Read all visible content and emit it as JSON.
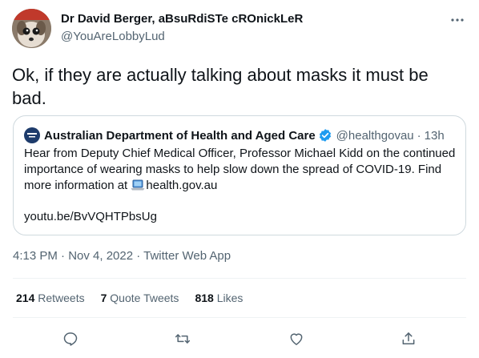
{
  "author": {
    "name": "Dr David Berger, aBsuRdiSTe cROnickLeR",
    "handle": "@YouAreLobbyLud"
  },
  "tweet": {
    "text": "Ok, if they are actually talking about masks it must be bad."
  },
  "quote": {
    "name": "Australian Department of Health and Aged Care",
    "handle": "@healthgovau",
    "separator": "·",
    "time": "13h",
    "body_line1": "Hear from Deputy Chief Medical Officer, Professor Michael Kidd on the continued",
    "body_line2": "importance of wearing masks to help slow down the spread of COVID-19. Find",
    "body_line3_prefix": "more information at ",
    "body_line3_link": "health.gov.au",
    "link": "youtu.be/BvVQHTPbsUg"
  },
  "meta": {
    "text": "4:13 PM · Nov 4, 2022 · Twitter Web App"
  },
  "stats": {
    "retweets_count": "214",
    "retweets_label": "Retweets",
    "quotes_count": "7",
    "quotes_label": "Quote Tweets",
    "likes_count": "818",
    "likes_label": "Likes"
  },
  "icons": {
    "more": "more-icon",
    "verified": "verified-icon",
    "laptop": "laptop-icon",
    "reply": "reply-icon",
    "retweet": "retweet-icon",
    "like": "heart-icon",
    "share": "share-icon"
  },
  "colors": {
    "text": "#0f1419",
    "secondary": "#536471",
    "accent": "#1d9bf0",
    "border": "#cfd9de"
  }
}
